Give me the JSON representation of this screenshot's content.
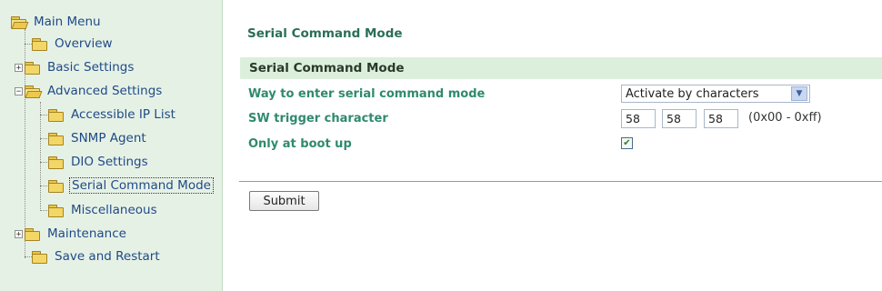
{
  "sidebar": {
    "root": "Main Menu",
    "items": [
      {
        "label": "Overview"
      },
      {
        "label": "Basic Settings",
        "expander": "+"
      },
      {
        "label": "Advanced Settings",
        "expander": "−"
      },
      {
        "label": "Accessible IP List"
      },
      {
        "label": "SNMP Agent"
      },
      {
        "label": "DIO Settings"
      },
      {
        "label": "Serial Command Mode",
        "selected": true
      },
      {
        "label": "Miscellaneous"
      },
      {
        "label": "Maintenance",
        "expander": "+"
      },
      {
        "label": "Save and Restart"
      }
    ]
  },
  "main": {
    "page_title": "Serial Command Mode",
    "section_title": "Serial Command Mode",
    "fields": {
      "enter_mode_label": "Way to enter serial command mode",
      "enter_mode_value": "Activate by characters",
      "trigger_label": "SW trigger character",
      "trigger_values": [
        "58",
        "58",
        "58"
      ],
      "trigger_range": "(0x00 - 0xff)",
      "boot_label": "Only at boot up",
      "boot_checked": true
    },
    "submit_label": "Submit"
  },
  "colors": {
    "sidebar_bg": "#e6f1e6",
    "section_header_bg": "#dcefdc",
    "label_green": "#2f8a6e",
    "link_blue": "#1f4a86"
  },
  "icons": [
    "folder-open-icon",
    "folder-icon",
    "expand-plus-icon",
    "collapse-minus-icon",
    "chevron-down-icon",
    "check-icon"
  ]
}
